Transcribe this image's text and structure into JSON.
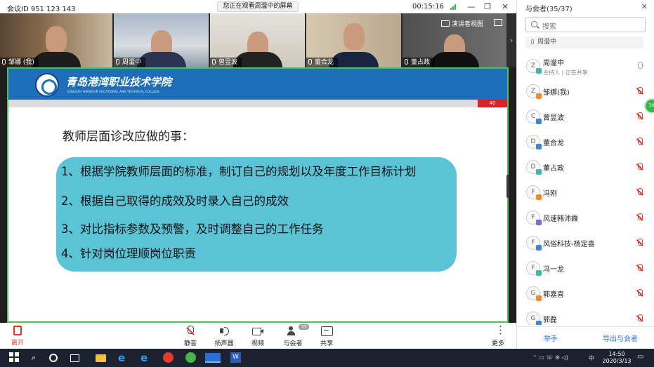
{
  "titlebar": {
    "meeting_id": "会议ID 951 123 143",
    "watching": "您正在观看周瀣中的屏幕",
    "elapsed": "00:15:16",
    "minimize": "—",
    "restore": "❐",
    "close": "✕"
  },
  "strip": {
    "speaker_view": "演讲者视图",
    "tiles": [
      {
        "name": "邹娜 (我)"
      },
      {
        "name": "周瀣中"
      },
      {
        "name": "曾昱波"
      },
      {
        "name": "董合龙"
      },
      {
        "name": "董占政"
      }
    ],
    "arrow": "›"
  },
  "slide": {
    "college_cn": "青岛港湾职业技术学院",
    "college_en": "QINGDAO HARBOUR VOCATIONAL AND TECHNICAL COLLEGE",
    "page": "40",
    "heading": "教师层面诊改应做的事：",
    "items": [
      "1、根据学院教师层面的标准，制订自己的规划以及年度工作目标计划",
      "2、根据自己取得的成效及时录入自己的成效",
      "3、对比指标参数及预警，及时调整自己的工作任务",
      "4、针对岗位理顺岗位职责"
    ]
  },
  "toolbar": {
    "leave": "离开",
    "mute": "静音",
    "speaker": "扬声器",
    "video": "视频",
    "participants": "与会者",
    "participants_count": "35",
    "share": "共享",
    "more": "更多"
  },
  "panel": {
    "title": "与会者(35/37)",
    "close": "✕",
    "search_placeholder": "搜索",
    "presenter": "周瀣中",
    "host_role": "主持人 | 正在共享",
    "participants": [
      {
        "initial": "Z",
        "name": "周瀣中",
        "color": "g"
      },
      {
        "initial": "Z",
        "name": "邹娜(我)",
        "color": "o"
      },
      {
        "initial": "C",
        "name": "曾昱波",
        "color": "b"
      },
      {
        "initial": "D",
        "name": "董合龙",
        "color": "b"
      },
      {
        "initial": "D",
        "name": "董占政",
        "color": "g"
      },
      {
        "initial": "F",
        "name": "冯刚",
        "color": "o"
      },
      {
        "initial": "F",
        "name": "风速韩沛霖",
        "color": "v"
      },
      {
        "initial": "F",
        "name": "风俗科技-杨定喜",
        "color": "b"
      },
      {
        "initial": "F",
        "name": "冯一龙",
        "color": "g"
      },
      {
        "initial": "G",
        "name": "郭嘉喜",
        "color": "o"
      },
      {
        "initial": "G",
        "name": "郭磊",
        "color": "b"
      }
    ],
    "raise_hand": "举手",
    "export": "导出与会者",
    "floating_badge": "56"
  },
  "taskbar": {
    "time": "14:50",
    "date": "2020/3/13",
    "lang": "中"
  }
}
